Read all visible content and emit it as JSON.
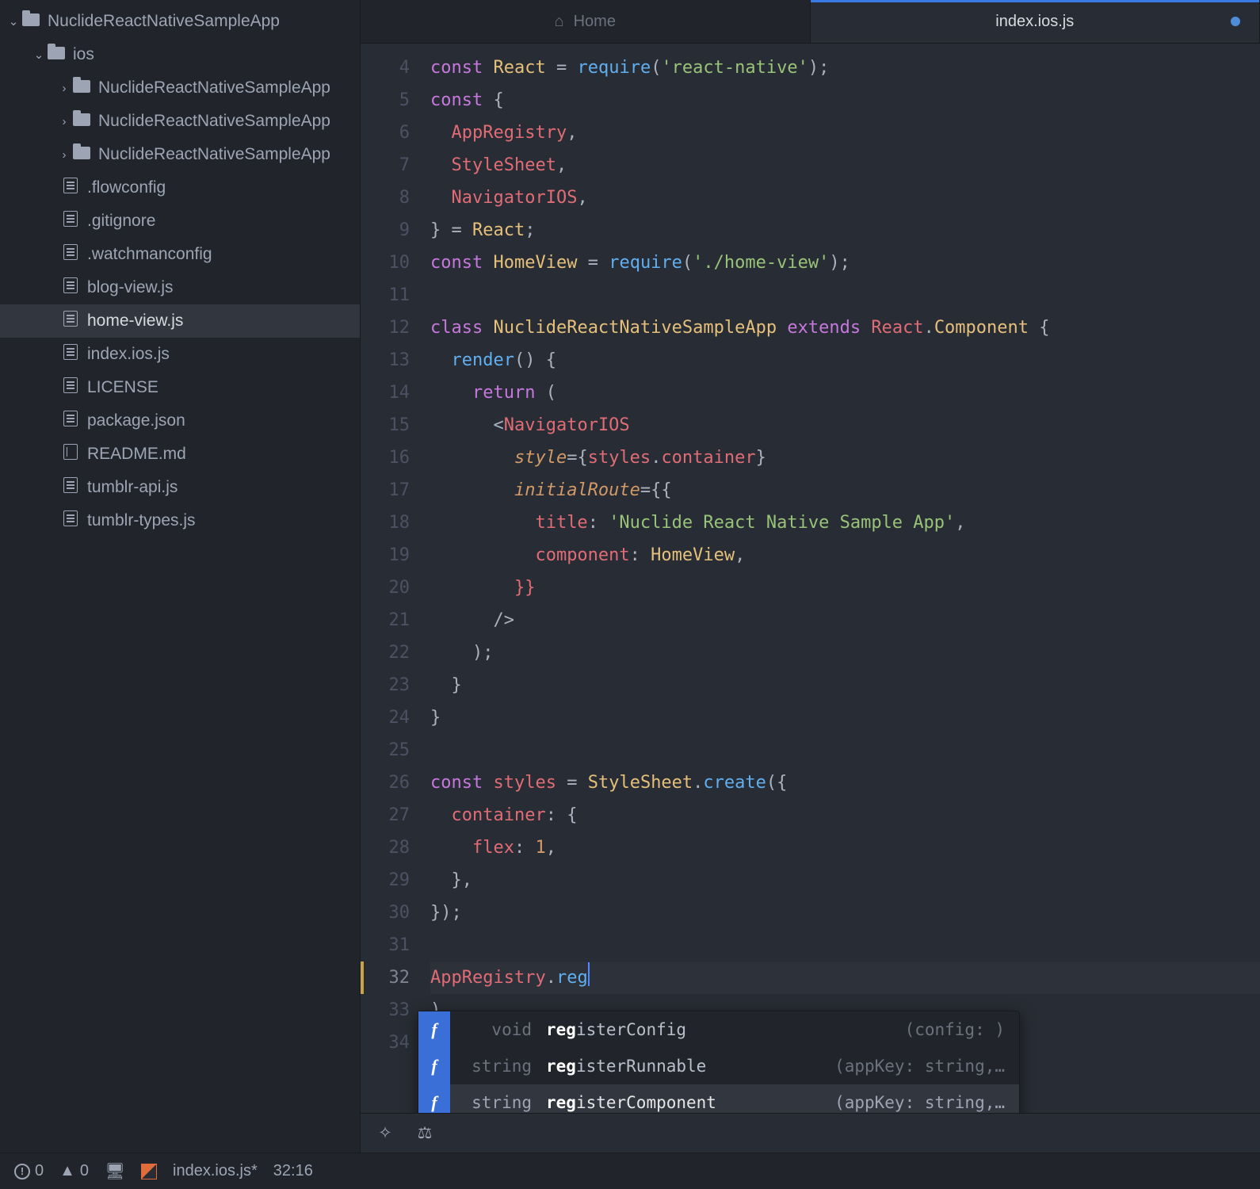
{
  "tree": {
    "root": {
      "label": "NuclideReactNativeSampleApp",
      "expanded": true
    },
    "ios": {
      "label": "ios",
      "expanded": true
    },
    "ios_children": [
      "NuclideReactNativeSampleApp",
      "NuclideReactNativeSampleApp",
      "NuclideReactNativeSampleApp"
    ],
    "files": [
      {
        "name": ".flowconfig",
        "icon": "file"
      },
      {
        "name": ".gitignore",
        "icon": "file"
      },
      {
        "name": ".watchmanconfig",
        "icon": "file"
      },
      {
        "name": "blog-view.js",
        "icon": "file"
      },
      {
        "name": "home-view.js",
        "icon": "file",
        "selected": true
      },
      {
        "name": "index.ios.js",
        "icon": "file"
      },
      {
        "name": "LICENSE",
        "icon": "file"
      },
      {
        "name": "package.json",
        "icon": "file"
      },
      {
        "name": "README.md",
        "icon": "book"
      },
      {
        "name": "tumblr-api.js",
        "icon": "file"
      },
      {
        "name": "tumblr-types.js",
        "icon": "file"
      }
    ]
  },
  "tabs": [
    {
      "label": "Home",
      "icon": "home",
      "active": false
    },
    {
      "label": "index.ios.js",
      "active": true,
      "modified": true
    }
  ],
  "code": {
    "first_line": 4,
    "cursor_line": 32,
    "lines": [
      {
        "n": 4,
        "html": "<span class='kw'>const</span> <span class='cls'>React</span> <span class='pun'>=</span> <span class='fn'>require</span><span class='pun'>(</span><span class='str'>'react-native'</span><span class='pun'>);</span>"
      },
      {
        "n": 5,
        "html": "<span class='kw'>const</span> <span class='pun'>{</span>"
      },
      {
        "n": 6,
        "html": "  <span class='red'>AppRegistry</span><span class='pun'>,</span>"
      },
      {
        "n": 7,
        "html": "  <span class='red'>StyleSheet</span><span class='pun'>,</span>"
      },
      {
        "n": 8,
        "html": "  <span class='red'>NavigatorIOS</span><span class='pun'>,</span>"
      },
      {
        "n": 9,
        "html": "<span class='pun'>} =</span> <span class='cls'>React</span><span class='pun'>;</span>"
      },
      {
        "n": 10,
        "html": "<span class='kw'>const</span> <span class='cls'>HomeView</span> <span class='pun'>=</span> <span class='fn'>require</span><span class='pun'>(</span><span class='str'>'./home-view'</span><span class='pun'>);</span>"
      },
      {
        "n": 11,
        "html": ""
      },
      {
        "n": 12,
        "html": "<span class='kw'>class</span> <span class='cls'>NuclideReactNativeSampleApp</span> <span class='kw'>extends</span> <span class='red'>React</span><span class='pun'>.</span><span class='cls'>Component</span> <span class='pun'>{</span>"
      },
      {
        "n": 13,
        "html": "  <span class='fn'>render</span><span class='pun'>() {</span>"
      },
      {
        "n": 14,
        "html": "    <span class='kw'>return</span> <span class='pun'>(</span>"
      },
      {
        "n": 15,
        "html": "      <span class='pun'>&lt;</span><span class='red'>NavigatorIOS</span>"
      },
      {
        "n": 16,
        "html": "        <span class='attr'>style</span><span class='pun'>={</span><span class='red'>styles</span><span class='pun'>.</span><span class='red'>container</span><span class='pun'>}</span>"
      },
      {
        "n": 17,
        "html": "        <span class='attr'>initialRoute</span><span class='pun'>={{</span>"
      },
      {
        "n": 18,
        "html": "          <span class='red'>title</span><span class='pun'>:</span> <span class='str'>'Nuclide React Native Sample App'</span><span class='pun'>,</span>"
      },
      {
        "n": 19,
        "html": "          <span class='red'>component</span><span class='pun'>:</span> <span class='cls'>HomeView</span><span class='pun'>,</span>"
      },
      {
        "n": 20,
        "html": "        <span class='red'>}}</span>"
      },
      {
        "n": 21,
        "html": "      <span class='pun'>/&gt;</span>"
      },
      {
        "n": 22,
        "html": "    <span class='pun'>);</span>"
      },
      {
        "n": 23,
        "html": "  <span class='pun'>}</span>"
      },
      {
        "n": 24,
        "html": "<span class='pun'>}</span>"
      },
      {
        "n": 25,
        "html": ""
      },
      {
        "n": 26,
        "html": "<span class='kw'>const</span> <span class='red'>styles</span> <span class='pun'>=</span> <span class='cls'>StyleSheet</span><span class='pun'>.</span><span class='fn'>create</span><span class='pun'>({</span>"
      },
      {
        "n": 27,
        "html": "  <span class='red'>container</span><span class='pun'>: {</span>"
      },
      {
        "n": 28,
        "html": "    <span class='red'>flex</span><span class='pun'>:</span> <span class='num'>1</span><span class='pun'>,</span>"
      },
      {
        "n": 29,
        "html": "  <span class='pun'>},</span>"
      },
      {
        "n": 30,
        "html": "<span class='pun'>});</span>"
      },
      {
        "n": 31,
        "html": ""
      },
      {
        "n": 32,
        "html": "<span class='red'>AppRegistry</span><span class='pun'>.</span><span class='fn'>reg</span><span class='cursor'></span>",
        "cur": true
      },
      {
        "n": 33,
        "html": "<span class='pun'>)</span>"
      },
      {
        "n": 34,
        "html": ""
      }
    ]
  },
  "autocomplete": {
    "items": [
      {
        "ret": "void",
        "bold": "reg",
        "rest": "isterConfig",
        "sig": "(config: )"
      },
      {
        "ret": "string",
        "bold": "reg",
        "rest": "isterRunnable",
        "sig": "(appKey: string,…"
      },
      {
        "ret": "string",
        "bold": "reg",
        "rest": "isterComponent",
        "sig": "(appKey: string,…",
        "selected": true
      }
    ]
  },
  "status": {
    "errors": "0",
    "warnings": "0",
    "filename": "index.ios.js*",
    "cursor": "32:16"
  }
}
